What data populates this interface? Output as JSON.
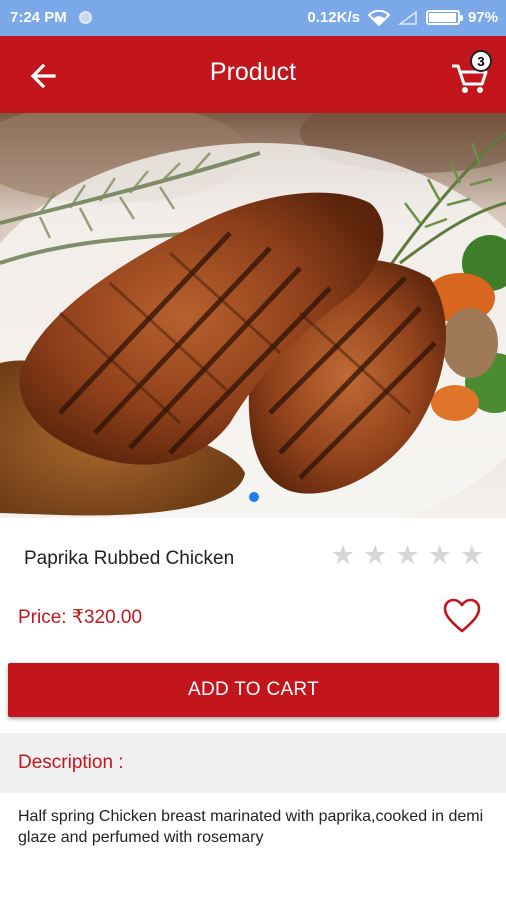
{
  "status_bar": {
    "time": "7:24 PM",
    "network_speed": "0.12K/s",
    "battery": "97%",
    "battery_level": 0.97
  },
  "app_bar": {
    "title": "Product",
    "cart_count": "3",
    "back_icon": "arrow-left-icon",
    "cart_icon": "shopping-cart-icon"
  },
  "carousel": {
    "image_subject": "grilled-chicken-photo",
    "active_index": 0,
    "total": 1
  },
  "product": {
    "name": "Paprika Rubbed Chicken",
    "rating": 0,
    "max_rating": 5,
    "price": "Price: ₹320.00"
  },
  "actions": {
    "add_to_cart": "ADD TO CART",
    "wishlist_icon": "heart-outline-icon"
  },
  "description": {
    "heading": "Description :",
    "text": "Half spring Chicken breast marinated with paprika,cooked in demi glaze and perfumed with rosemary"
  },
  "colors": {
    "primary": "#c3161c",
    "status_bar": "#7aa8e9",
    "accent_dot": "#1e7cf2",
    "star_inactive": "#d6d6d6"
  }
}
